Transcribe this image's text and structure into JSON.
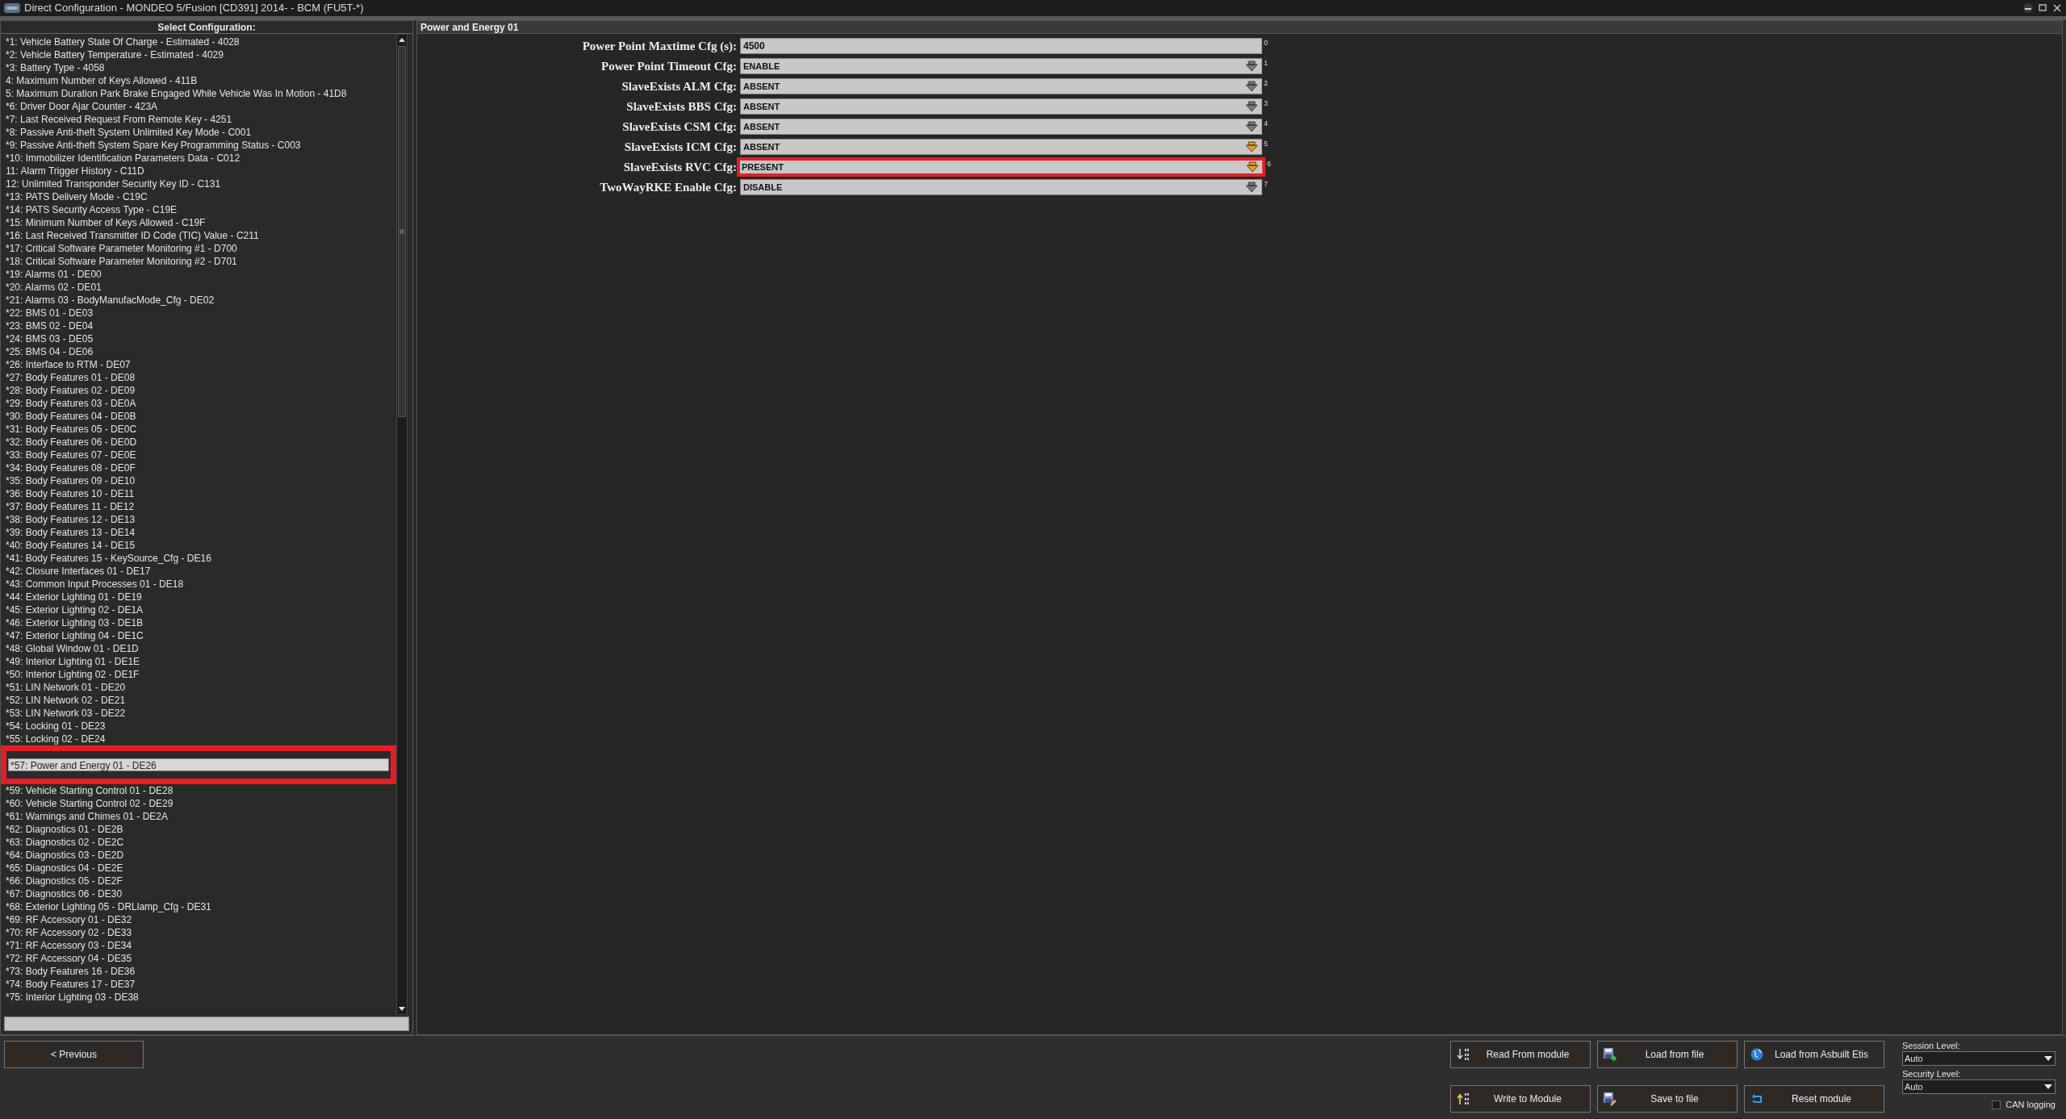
{
  "window": {
    "title": "Direct Configuration - MONDEO 5/Fusion [CD391] 2014- - BCM (FU5T-*)"
  },
  "config_list": {
    "title": "Select Configuration:",
    "items": [
      {
        "label": "*1: Vehicle Battery State Of Charge - Estimated - 4028",
        "selected": false
      },
      {
        "label": "*2: Vehicle Battery Temperature - Estimated - 4029",
        "selected": false
      },
      {
        "label": "*3: Battery Type - 4058",
        "selected": false
      },
      {
        "label": "4: Maximum Number of Keys Allowed - 411B",
        "selected": false
      },
      {
        "label": "5: Maximum Duration Park Brake Engaged While Vehicle Was In Motion - 41D8",
        "selected": false
      },
      {
        "label": "*6: Driver Door Ajar Counter - 423A",
        "selected": false
      },
      {
        "label": "*7: Last Received Request From Remote Key - 4251",
        "selected": false
      },
      {
        "label": "*8: Passive Anti-theft System Unlimited Key Mode - C001",
        "selected": false
      },
      {
        "label": "*9: Passive Anti-theft System Spare Key Programming Status - C003",
        "selected": false
      },
      {
        "label": "*10: Immobilizer Identification Parameters Data - C012",
        "selected": false
      },
      {
        "label": "11: Alarm Trigger History - C11D",
        "selected": false
      },
      {
        "label": "12: Unlimited Transponder Security Key ID - C131",
        "selected": false
      },
      {
        "label": "*13: PATS Delivery Mode - C19C",
        "selected": false
      },
      {
        "label": "*14: PATS Security Access Type - C19E",
        "selected": false
      },
      {
        "label": "*15: Minimum Number of Keys Allowed - C19F",
        "selected": false
      },
      {
        "label": "*16: Last Received Transmitter ID Code (TIC) Value - C211",
        "selected": false
      },
      {
        "label": "*17: Critical Software Parameter Monitoring #1 - D700",
        "selected": false
      },
      {
        "label": "*18: Critical Software Parameter Monitoring #2 - D701",
        "selected": false
      },
      {
        "label": "*19: Alarms 01 - DE00",
        "selected": false
      },
      {
        "label": "*20: Alarms 02 - DE01",
        "selected": false
      },
      {
        "label": "*21: Alarms 03 - BodyManufacMode_Cfg - DE02",
        "selected": false
      },
      {
        "label": "*22: BMS 01 - DE03",
        "selected": false
      },
      {
        "label": "*23: BMS 02 - DE04",
        "selected": false
      },
      {
        "label": "*24: BMS 03 - DE05",
        "selected": false
      },
      {
        "label": "*25: BMS 04 - DE06",
        "selected": false
      },
      {
        "label": "*26: Interface to RTM - DE07",
        "selected": false
      },
      {
        "label": "*27: Body Features 01 - DE08",
        "selected": false
      },
      {
        "label": "*28: Body Features 02 - DE09",
        "selected": false
      },
      {
        "label": "*29: Body Features 03 - DE0A",
        "selected": false
      },
      {
        "label": "*30: Body Features 04 - DE0B",
        "selected": false
      },
      {
        "label": "*31: Body Features 05 - DE0C",
        "selected": false
      },
      {
        "label": "*32: Body Features 06 - DE0D",
        "selected": false
      },
      {
        "label": "*33: Body Features 07 - DE0E",
        "selected": false
      },
      {
        "label": "*34: Body Features 08 - DE0F",
        "selected": false
      },
      {
        "label": "*35: Body Features 09 - DE10",
        "selected": false
      },
      {
        "label": "*36: Body Features 10 - DE11",
        "selected": false
      },
      {
        "label": "*37: Body Features 11 - DE12",
        "selected": false
      },
      {
        "label": "*38: Body Features 12 - DE13",
        "selected": false
      },
      {
        "label": "*39: Body Features 13 - DE14",
        "selected": false
      },
      {
        "label": "*40: Body Features 14 - DE15",
        "selected": false
      },
      {
        "label": "*41: Body Features 15 - KeySource_Cfg - DE16",
        "selected": false
      },
      {
        "label": "*42: Closure Interfaces 01 - DE17",
        "selected": false
      },
      {
        "label": "*43: Common Input Processes 01 - DE18",
        "selected": false
      },
      {
        "label": "*44: Exterior Lighting 01 - DE19",
        "selected": false
      },
      {
        "label": "*45: Exterior Lighting 02 - DE1A",
        "selected": false
      },
      {
        "label": "*46: Exterior Lighting 03 - DE1B",
        "selected": false
      },
      {
        "label": "*47: Exterior Lighting 04 - DE1C",
        "selected": false
      },
      {
        "label": "*48: Global Window 01 - DE1D",
        "selected": false
      },
      {
        "label": "*49: Interior Lighting 01 - DE1E",
        "selected": false
      },
      {
        "label": "*50: Interior Lighting 02 - DE1F",
        "selected": false
      },
      {
        "label": "*51: LIN Network 01 - DE20",
        "selected": false
      },
      {
        "label": "*52: LIN Network 02 - DE21",
        "selected": false
      },
      {
        "label": "*53: LIN Network 03 - DE22",
        "selected": false
      },
      {
        "label": "*54: Locking 01 - DE23",
        "selected": false
      },
      {
        "label": "*55: Locking 02 - DE24",
        "selected": false
      },
      {
        "label": "*57: Power and Energy 01 - DE26",
        "selected": true,
        "highlighted": true
      },
      {
        "label": "*59: Vehicle Starting Control 01 - DE28",
        "selected": false
      },
      {
        "label": "*60: Vehicle Starting Control 02 - DE29",
        "selected": false
      },
      {
        "label": "*61: Warnings and Chimes 01 - DE2A",
        "selected": false
      },
      {
        "label": "*62: Diagnostics 01 - DE2B",
        "selected": false
      },
      {
        "label": "*63: Diagnostics 02 - DE2C",
        "selected": false
      },
      {
        "label": "*64: Diagnostics 03 - DE2D",
        "selected": false
      },
      {
        "label": "*65: Diagnostics 04 - DE2E",
        "selected": false
      },
      {
        "label": "*66: Diagnostics 05 - DE2F",
        "selected": false
      },
      {
        "label": "*67: Diagnostics 06 - DE30",
        "selected": false
      },
      {
        "label": "*68: Exterior Lighting 05 - DRLlamp_Cfg - DE31",
        "selected": false
      },
      {
        "label": "*69: RF Accessory 01 - DE32",
        "selected": false
      },
      {
        "label": "*70: RF Accessory 02 - DE33",
        "selected": false
      },
      {
        "label": "*71: RF Accessory 03 - DE34",
        "selected": false
      },
      {
        "label": "*72: RF Accessory 04 - DE35",
        "selected": false
      },
      {
        "label": "*73: Body Features 16 - DE36",
        "selected": false
      },
      {
        "label": "*74: Body Features 17 - DE37",
        "selected": false
      },
      {
        "label": "*75: Interior Lighting 03 - DE38",
        "selected": false
      }
    ]
  },
  "form": {
    "title": "Power and Energy 01",
    "fields": [
      {
        "kind": "text",
        "label": "Power Point Maxtime Cfg (s):",
        "value": "4500",
        "index": "0",
        "highlighted": false
      },
      {
        "kind": "select",
        "label": "Power Point Timeout Cfg:",
        "value": "ENABLE",
        "index": "1",
        "modified": false,
        "highlighted": false
      },
      {
        "kind": "select",
        "label": "SlaveExists ALM Cfg:",
        "value": "ABSENT",
        "index": "2",
        "modified": false,
        "highlighted": false
      },
      {
        "kind": "select",
        "label": "SlaveExists BBS Cfg:",
        "value": "ABSENT",
        "index": "3",
        "modified": false,
        "highlighted": false
      },
      {
        "kind": "select",
        "label": "SlaveExists CSM Cfg:",
        "value": "ABSENT",
        "index": "4",
        "modified": false,
        "highlighted": false
      },
      {
        "kind": "select",
        "label": "SlaveExists ICM Cfg:",
        "value": "ABSENT",
        "index": "5",
        "modified": true,
        "highlighted": false
      },
      {
        "kind": "select",
        "label": "SlaveExists RVC Cfg:",
        "value": "PRESENT",
        "index": "6",
        "modified": true,
        "highlighted": true
      },
      {
        "kind": "select",
        "label": "TwoWayRKE Enable Cfg:",
        "value": "DISABLE",
        "index": "7",
        "modified": false,
        "highlighted": false
      }
    ]
  },
  "previous_button": "< Previous",
  "actions": [
    {
      "kind": "read",
      "label": "Read From module"
    },
    {
      "kind": "load",
      "label": "Load from file"
    },
    {
      "kind": "asbuilt",
      "label": "Load from Asbuilt Etis"
    },
    {
      "kind": "write",
      "label": "Write to Module"
    },
    {
      "kind": "save",
      "label": "Save to file"
    },
    {
      "kind": "reset",
      "label": "Reset module"
    }
  ],
  "session_level": {
    "label": "Session Level:",
    "value": "Auto"
  },
  "security_level": {
    "label": "Security Level:",
    "value": "Auto"
  },
  "can_logging": {
    "label": "CAN logging",
    "checked": false
  }
}
